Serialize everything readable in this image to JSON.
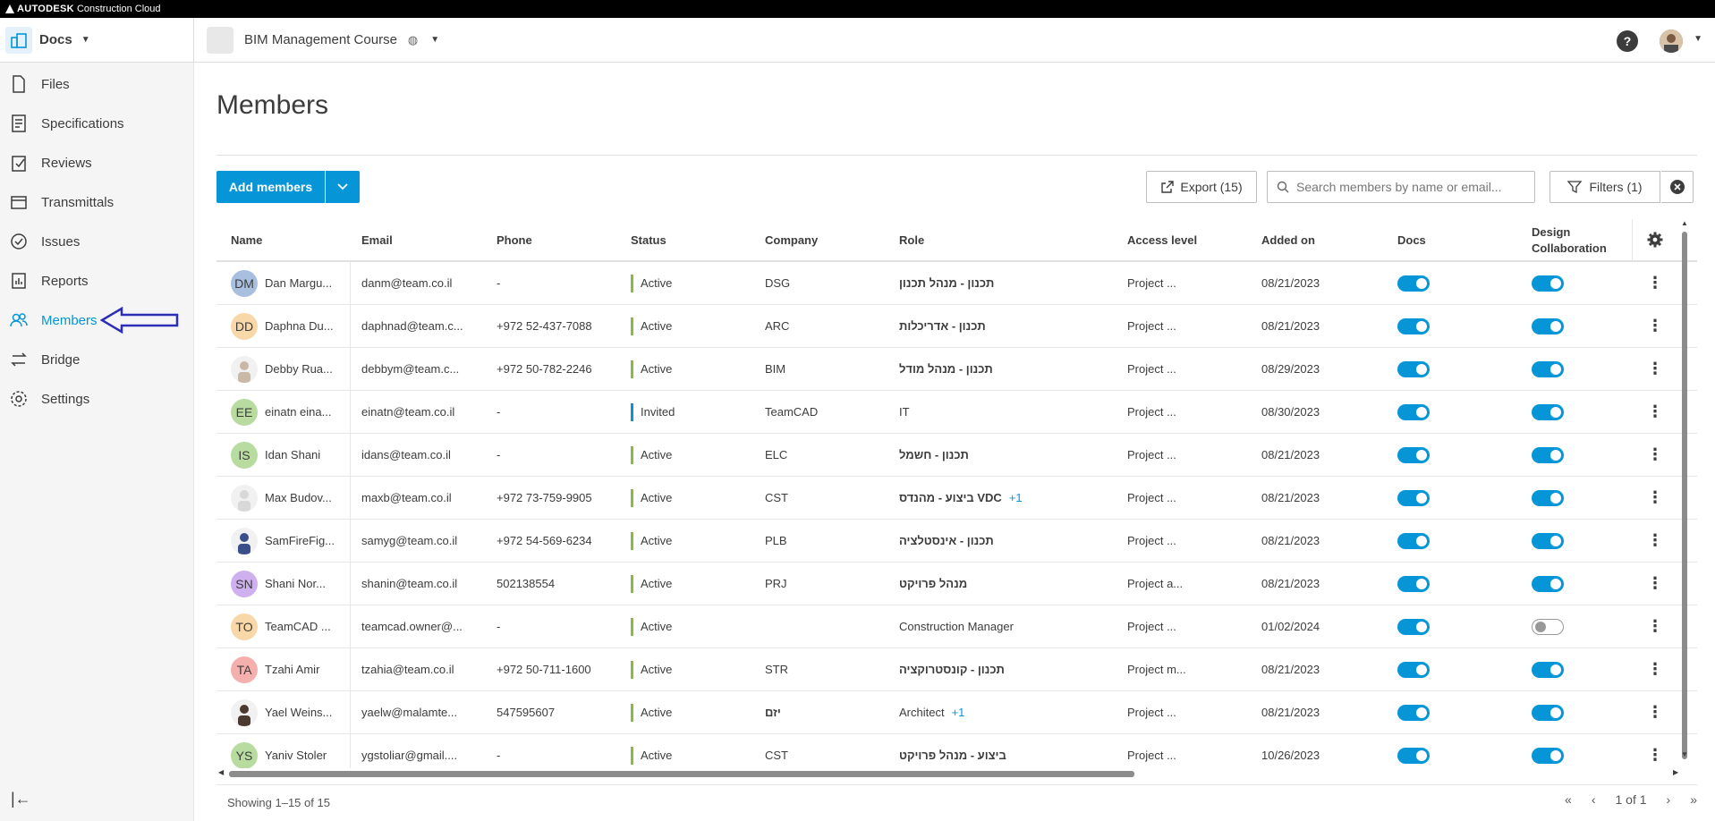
{
  "brand": {
    "name": "AUTODESK",
    "product": "Construction Cloud"
  },
  "header": {
    "product": "Docs",
    "project": "BIM Management Course",
    "help_label": "?"
  },
  "sidebar": {
    "items": [
      {
        "label": "Files",
        "icon": "file-icon"
      },
      {
        "label": "Specifications",
        "icon": "specifications-icon"
      },
      {
        "label": "Reviews",
        "icon": "reviews-icon"
      },
      {
        "label": "Transmittals",
        "icon": "transmittals-icon"
      },
      {
        "label": "Issues",
        "icon": "issues-icon"
      },
      {
        "label": "Reports",
        "icon": "reports-icon"
      },
      {
        "label": "Members",
        "icon": "members-icon",
        "active": true
      },
      {
        "label": "Bridge",
        "icon": "bridge-icon"
      },
      {
        "label": "Settings",
        "icon": "settings-icon"
      }
    ]
  },
  "page": {
    "title": "Members"
  },
  "toolbar": {
    "add_label": "Add members",
    "export_label": "Export (15)",
    "search_placeholder": "Search members by name or email...",
    "filter_label": "Filters (1)"
  },
  "table": {
    "columns": [
      "Name",
      "Email",
      "Phone",
      "Status",
      "Company",
      "Role",
      "Access level",
      "Added on",
      "Docs",
      "Design",
      "Collaboration"
    ],
    "rows": [
      {
        "initials": "DM",
        "avatar_color": "#a8bfe0",
        "name": "Dan Margu...",
        "email": "danm@team.co.il",
        "phone": "-",
        "status": "Active",
        "company": "DSG",
        "role": "תכנון - מנהל תכנון",
        "role_bold": true,
        "extra": "",
        "access": "Project ...",
        "added": "08/21/2023",
        "docs": true,
        "design": true
      },
      {
        "initials": "DD",
        "avatar_color": "#f8d7a8",
        "name": "Daphna Du...",
        "email": "daphnad@team.c...",
        "phone": "+972 52-437-7088",
        "status": "Active",
        "company": "ARC",
        "role": "תכנון - אדריכלות",
        "role_bold": true,
        "extra": "",
        "access": "Project ...",
        "added": "08/21/2023",
        "docs": true,
        "design": true
      },
      {
        "photo": true,
        "photo_color": "#c9b8a6",
        "name": "Debby Rua...",
        "email": "debbym@team.c...",
        "phone": "+972 50-782-2246",
        "status": "Active",
        "company": "BIM",
        "role": "תכנון - מנהל מודל",
        "role_bold": true,
        "extra": "",
        "access": "Project ...",
        "added": "08/29/2023",
        "docs": true,
        "design": true
      },
      {
        "initials": "EE",
        "avatar_color": "#b8dca0",
        "name": "einatn eina...",
        "email": "einatn@team.co.il",
        "phone": "-",
        "status": "Invited",
        "company": "TeamCAD",
        "role": "IT",
        "role_bold": false,
        "extra": "",
        "access": "Project ...",
        "added": "08/30/2023",
        "docs": true,
        "design": true
      },
      {
        "initials": "IS",
        "avatar_color": "#b8dca0",
        "name": "Idan Shani",
        "email": "idans@team.co.il",
        "phone": "-",
        "status": "Active",
        "company": "ELC",
        "role": "תכנון - חשמל",
        "role_bold": true,
        "extra": "",
        "access": "Project ...",
        "added": "08/21/2023",
        "docs": true,
        "design": true
      },
      {
        "photo": true,
        "photo_color": "#d8d8d8",
        "name": "Max Budov...",
        "email": "maxb@team.co.il",
        "phone": "+972 73-759-9905",
        "status": "Active",
        "company": "CST",
        "role": "ביצוע - מהנדס VDC",
        "role_bold": true,
        "extra": "+1",
        "access": "Project ...",
        "added": "08/21/2023",
        "docs": true,
        "design": true
      },
      {
        "photo": true,
        "photo_color": "#3a4f8a",
        "name": "SamFireFig...",
        "email": "samyg@team.co.il",
        "phone": "+972 54-569-6234",
        "status": "Active",
        "company": "PLB",
        "role": "תכנון - אינסטלציה",
        "role_bold": true,
        "extra": "",
        "access": "Project ...",
        "added": "08/21/2023",
        "docs": true,
        "design": true
      },
      {
        "initials": "SN",
        "avatar_color": "#cfb0ef",
        "name": "Shani Nor...",
        "email": "shanin@team.co.il",
        "phone": "502138554",
        "status": "Active",
        "company": "PRJ",
        "role": "מנהל פרויקט",
        "role_bold": true,
        "extra": "",
        "access": "Project a...",
        "added": "08/21/2023",
        "docs": true,
        "design": true
      },
      {
        "initials": "TO",
        "avatar_color": "#f8d7a8",
        "name": "TeamCAD ...",
        "email": "teamcad.owner@...",
        "phone": "-",
        "status": "Active",
        "company": "",
        "role": "Construction Manager",
        "role_bold": false,
        "extra": "",
        "access": "Project ...",
        "added": "01/02/2024",
        "docs": true,
        "design": false
      },
      {
        "initials": "TA",
        "avatar_color": "#f5b0ae",
        "name": "Tzahi Amir",
        "email": "tzahia@team.co.il",
        "phone": "+972 50-711-1600",
        "status": "Active",
        "company": "STR",
        "role": "תכנון - קונסטרוקציה",
        "role_bold": true,
        "extra": "",
        "access": "Project m...",
        "added": "08/21/2023",
        "docs": true,
        "design": true
      },
      {
        "photo": true,
        "photo_color": "#4a3a30",
        "name": "Yael Weins...",
        "email": "yaelw@malamte...",
        "phone": "547595607",
        "status": "Active",
        "company": "יזם",
        "role": "Architect",
        "role_bold": false,
        "extra": "+1",
        "access": "Project ...",
        "added": "08/21/2023",
        "docs": true,
        "design": true
      },
      {
        "initials": "YS",
        "avatar_color": "#b8dca0",
        "name": "Yaniv Stoler",
        "email": "ygstoliar@gmail....",
        "phone": "-",
        "status": "Active",
        "company": "CST",
        "role": "ביצוע - מנהל פרויקט",
        "role_bold": true,
        "extra": "",
        "access": "Project ...",
        "added": "10/26/2023",
        "docs": true,
        "design": true
      }
    ]
  },
  "footer": {
    "showing": "Showing 1–15 of 15",
    "page": "1 of 1"
  }
}
